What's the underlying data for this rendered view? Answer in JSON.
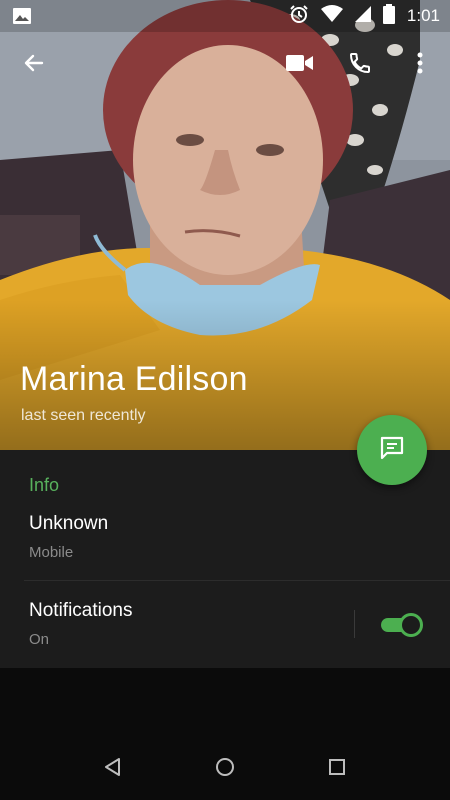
{
  "status_bar": {
    "time": "1:01",
    "icons": [
      "image-notification-icon",
      "alarm-icon",
      "wifi-icon",
      "cell-signal-icon",
      "battery-icon"
    ]
  },
  "toolbar": {
    "back_icon": "back-arrow-icon",
    "video_call_icon": "video-call-icon",
    "voice_call_icon": "phone-icon",
    "more_icon": "more-vertical-icon"
  },
  "profile": {
    "name": "Marina Edilson",
    "status": "last seen recently"
  },
  "fab": {
    "icon": "message-icon"
  },
  "info": {
    "section_title": "Info",
    "phone_value": "Unknown",
    "phone_label": "Mobile",
    "notifications_label": "Notifications",
    "notifications_value": "On",
    "notifications_enabled": true
  },
  "colors": {
    "accent": "#4caf50",
    "panel_bg": "#1c1c1c",
    "page_bg": "#0b0b0b"
  },
  "nav": {
    "icons": [
      "nav-back-icon",
      "nav-home-icon",
      "nav-recents-icon"
    ]
  }
}
